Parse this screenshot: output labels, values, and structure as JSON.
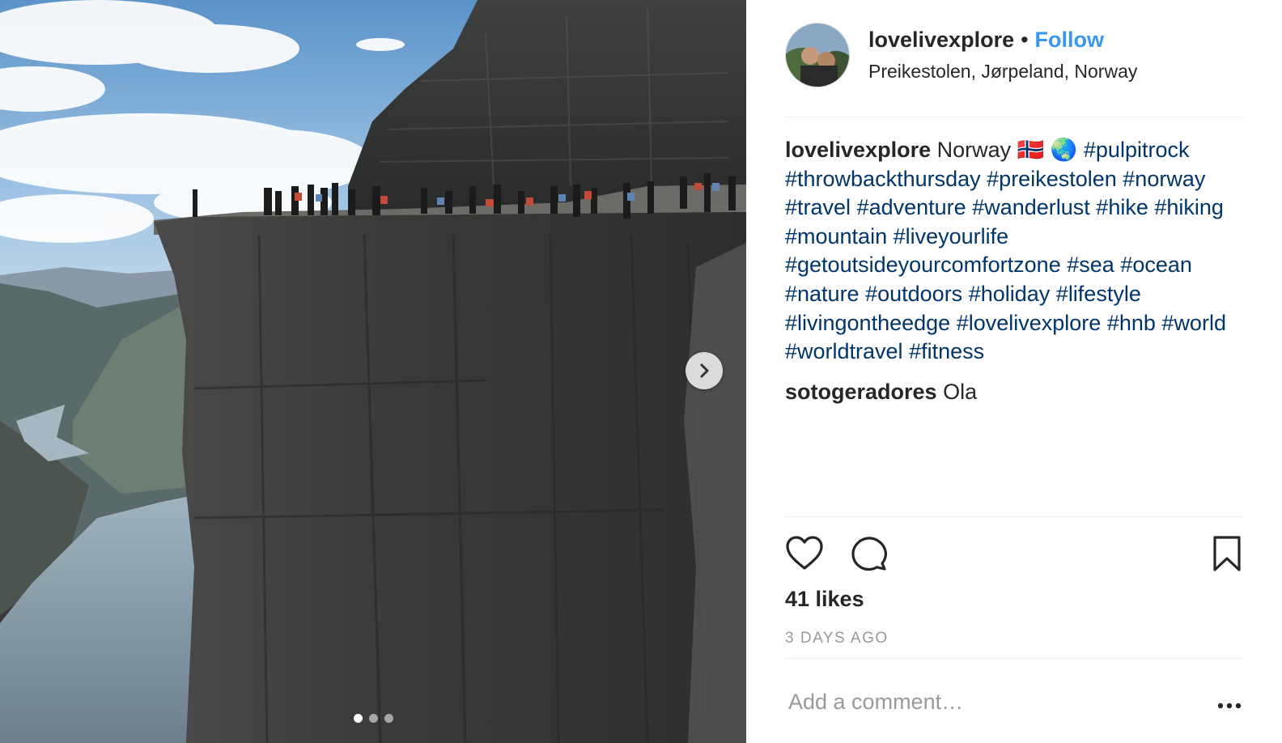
{
  "post": {
    "username": "lovelivexplore",
    "separator": "•",
    "follow_label": "Follow",
    "location": "Preikestolen, Jørpeland, Norway",
    "caption": {
      "author": "lovelivexplore",
      "text": "Norway 🇳🇴 🌏",
      "hashtags": [
        "#pulpitrock",
        "#throwbackthursday",
        "#preikestolen",
        "#norway",
        "#travel",
        "#adventure",
        "#wanderlust",
        "#hike",
        "#hiking",
        "#mountain",
        "#liveyourlife",
        "#getoutsideyourcomfortzone",
        "#sea",
        "#ocean",
        "#nature",
        "#outdoors",
        "#holiday",
        "#lifestyle",
        "#livingontheedge",
        "#lovelivexplore",
        "#hnb",
        "#world",
        "#worldtravel",
        "#fitness"
      ]
    },
    "comments": [
      {
        "author": "sotogeradores",
        "text": "Ola"
      }
    ],
    "likes": "41 likes",
    "timestamp": "3 DAYS AGO",
    "comment_placeholder": "Add a comment…"
  },
  "carousel": {
    "slides": 3,
    "active": 0
  },
  "icons": {
    "like": "heart-icon",
    "comment": "comment-bubble-icon",
    "save": "bookmark-icon",
    "more": "more-options-icon",
    "next": "chevron-right-icon"
  },
  "colors": {
    "link": "#3897f0",
    "hashtag": "#003569",
    "muted": "#999999",
    "text": "#262626"
  }
}
